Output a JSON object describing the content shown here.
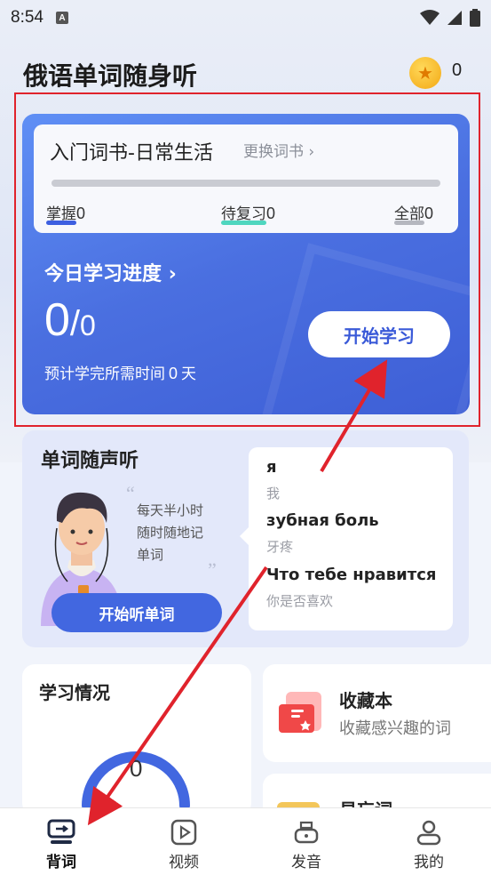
{
  "status_bar": {
    "time": "8:54",
    "badge": "A"
  },
  "header": {
    "title": "俄语单词随身听",
    "coin_count": "0"
  },
  "book": {
    "name": "入门词书-日常生活",
    "change_label": "更换词书",
    "progress": 0,
    "stats": [
      {
        "label": "掌握",
        "value": "0"
      },
      {
        "label": "待复习",
        "value": "0"
      },
      {
        "label": "全部",
        "value": "0"
      }
    ]
  },
  "today": {
    "label": "今日学习进度",
    "done": "0",
    "separator": "/",
    "total": "0",
    "eta_prefix": "预计学完所需时间",
    "eta_days": "0",
    "eta_unit": "天",
    "start_label": "开始学习"
  },
  "listen": {
    "title": "单词随声听",
    "quote_lines": [
      "每天半小时",
      "随时随地记",
      "单词"
    ],
    "button_label": "开始听单词",
    "words": [
      {
        "word": "я",
        "meaning": "我"
      },
      {
        "word": "зубная боль",
        "meaning": "牙疼"
      },
      {
        "word": "Что тебе нравится",
        "meaning": "你是否喜欢"
      }
    ]
  },
  "study": {
    "title": "学习情况",
    "value": "0"
  },
  "favorites": {
    "title": "收藏本",
    "subtitle": "收藏感兴趣的词"
  },
  "forget": {
    "title": "易忘词"
  },
  "tabs": [
    {
      "label": "背词",
      "icon": "monitor-chat-icon",
      "active": true
    },
    {
      "label": "视频",
      "icon": "video-play-icon",
      "active": false
    },
    {
      "label": "发音",
      "icon": "speaker-icon",
      "active": false
    },
    {
      "label": "我的",
      "icon": "profile-icon",
      "active": false
    }
  ],
  "colors": {
    "accent": "#4267e0",
    "highlight_box": "#e0232c",
    "coin": "#f3a814"
  }
}
